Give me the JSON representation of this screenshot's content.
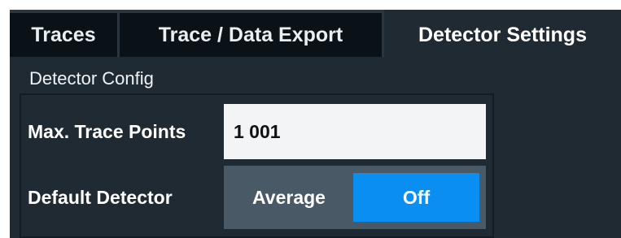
{
  "tabs": [
    {
      "label": "Traces",
      "active": false
    },
    {
      "label": "Trace / Data Export",
      "active": false
    },
    {
      "label": "Detector Settings",
      "active": true
    }
  ],
  "detector_config": {
    "section_title": "Detector Config",
    "max_trace_points": {
      "label": "Max. Trace Points",
      "value": "1 001"
    },
    "default_detector": {
      "label": "Default Detector",
      "options": [
        "Average",
        "Off"
      ],
      "selected": "Off"
    }
  },
  "colors": {
    "panel_background": "#1f2a33",
    "tab_inactive": "#0b1217",
    "selected_accent": "#0a8ef2",
    "toggle_background": "#4a5966"
  }
}
